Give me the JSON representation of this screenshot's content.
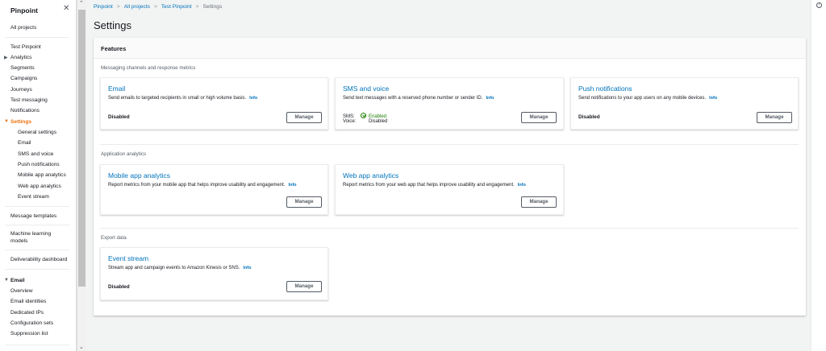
{
  "sidebar": {
    "title": "Pinpoint",
    "close_icon": "close-icon",
    "all_projects": "All projects",
    "project": "Test Pinpoint",
    "analytics": "Analytics",
    "segments": "Segments",
    "campaigns": "Campaigns",
    "journeys": "Journeys",
    "test_messaging": "Test messaging",
    "notifications": "Notifications",
    "settings": "Settings",
    "settings_items": [
      "General settings",
      "Email",
      "SMS and voice",
      "Push notifications",
      "Mobile app analytics",
      "Web app analytics",
      "Event stream"
    ],
    "message_templates": "Message templates",
    "ml_line1": "Machine learning",
    "ml_line2": "models",
    "deliverability": "Deliverability dashboard",
    "email_group": "Email",
    "email_items": [
      "Overview",
      "Email identities",
      "Dedicated IPs",
      "Configuration sets",
      "Suppression list"
    ]
  },
  "breadcrumb": [
    "Pinpoint",
    "All projects",
    "Test Pinpoint",
    "Settings"
  ],
  "page_title": "Settings",
  "features": {
    "title": "Features",
    "section_messaging": "Messaging channels and response metrics",
    "section_analytics": "Application analytics",
    "section_export": "Export data",
    "info_label": "Info",
    "manage_label": "Manage",
    "email": {
      "title": "Email",
      "desc": "Send emails to targeted recipients in small or high volume basis.",
      "status": "Disabled"
    },
    "sms": {
      "title": "SMS and voice",
      "desc": "Send text messages with a reserved phone number or sender ID.",
      "sms_key": "SMS:",
      "sms_val": "Enabled",
      "voice_key": "Voice:",
      "voice_val": "Disabled"
    },
    "push": {
      "title": "Push notifications",
      "desc": "Send notifications to your app users on any mobile devices.",
      "status": "Disabled"
    },
    "mobile": {
      "title": "Mobile app analytics",
      "desc": "Report metrics from your mobile app that helps improve usability and engagement."
    },
    "web": {
      "title": "Web app analytics",
      "desc": "Report metrics from your web app that helps improve usability and engagement."
    },
    "event": {
      "title": "Event stream",
      "desc": "Stream app and campaign events to Amazon Kinesis or SNS.",
      "status": "Disabled"
    }
  },
  "colors": {
    "link": "#0073bb",
    "active": "#ec7211",
    "success": "#1d8102"
  }
}
